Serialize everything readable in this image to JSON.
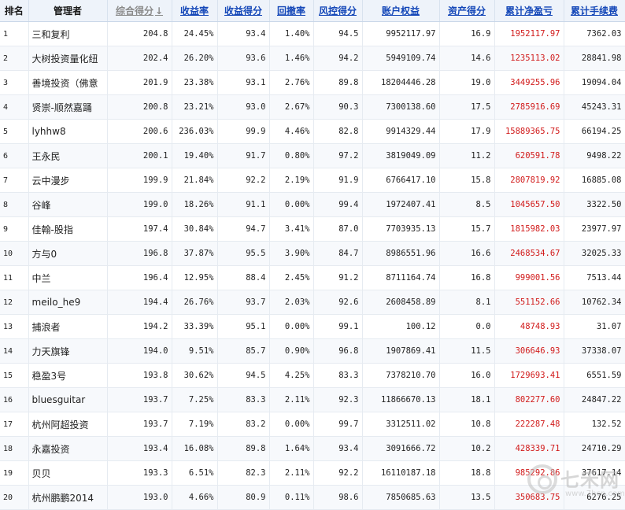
{
  "headers": {
    "rank": "排名",
    "manager": "管理者",
    "composite": "综合得分",
    "sort_arrow": "↓",
    "return_rate": "收益率",
    "return_score": "收益得分",
    "drawdown": "回撤率",
    "risk_score": "风控得分",
    "equity": "账户权益",
    "asset_score": "资产得分",
    "net_profit": "累计净盈亏",
    "fees": "累计手续费"
  },
  "rows": [
    {
      "rank": "1",
      "manager": "三和复利",
      "composite": "204.8",
      "return_rate": "24.45%",
      "return_score": "93.4",
      "drawdown": "1.40%",
      "risk_score": "94.5",
      "equity": "9952117.97",
      "asset_score": "16.9",
      "net_profit": "1952117.97",
      "fees": "7362.03"
    },
    {
      "rank": "2",
      "manager": "大树投资量化纽",
      "composite": "202.4",
      "return_rate": "26.20%",
      "return_score": "93.6",
      "drawdown": "1.46%",
      "risk_score": "94.2",
      "equity": "5949109.74",
      "asset_score": "14.6",
      "net_profit": "1235113.02",
      "fees": "28841.98"
    },
    {
      "rank": "3",
      "manager": "善境投资（佛意",
      "composite": "201.9",
      "return_rate": "23.38%",
      "return_score": "93.1",
      "drawdown": "2.76%",
      "risk_score": "89.8",
      "equity": "18204446.28",
      "asset_score": "19.0",
      "net_profit": "3449255.96",
      "fees": "19094.04"
    },
    {
      "rank": "4",
      "manager": "贤崇-顺然嘉踊",
      "composite": "200.8",
      "return_rate": "23.21%",
      "return_score": "93.0",
      "drawdown": "2.67%",
      "risk_score": "90.3",
      "equity": "7300138.60",
      "asset_score": "17.5",
      "net_profit": "2785916.69",
      "fees": "45243.31"
    },
    {
      "rank": "5",
      "manager": "lyhhw8",
      "composite": "200.6",
      "return_rate": "236.03%",
      "return_score": "99.9",
      "drawdown": "4.46%",
      "risk_score": "82.8",
      "equity": "9914329.44",
      "asset_score": "17.9",
      "net_profit": "15889365.75",
      "fees": "66194.25"
    },
    {
      "rank": "6",
      "manager": "王永民",
      "composite": "200.1",
      "return_rate": "19.40%",
      "return_score": "91.7",
      "drawdown": "0.80%",
      "risk_score": "97.2",
      "equity": "3819049.09",
      "asset_score": "11.2",
      "net_profit": "620591.78",
      "fees": "9498.22"
    },
    {
      "rank": "7",
      "manager": "云中漫步",
      "composite": "199.9",
      "return_rate": "21.84%",
      "return_score": "92.2",
      "drawdown": "2.19%",
      "risk_score": "91.9",
      "equity": "6766417.10",
      "asset_score": "15.8",
      "net_profit": "2807819.92",
      "fees": "16885.08"
    },
    {
      "rank": "8",
      "manager": "谷峰",
      "composite": "199.0",
      "return_rate": "18.26%",
      "return_score": "91.1",
      "drawdown": "0.00%",
      "risk_score": "99.4",
      "equity": "1972407.41",
      "asset_score": "8.5",
      "net_profit": "1045657.50",
      "fees": "3322.50"
    },
    {
      "rank": "9",
      "manager": "佳翰-股指",
      "composite": "197.4",
      "return_rate": "30.84%",
      "return_score": "94.7",
      "drawdown": "3.41%",
      "risk_score": "87.0",
      "equity": "7703935.13",
      "asset_score": "15.7",
      "net_profit": "1815982.03",
      "fees": "23977.97"
    },
    {
      "rank": "10",
      "manager": "方与0",
      "composite": "196.8",
      "return_rate": "37.87%",
      "return_score": "95.5",
      "drawdown": "3.90%",
      "risk_score": "84.7",
      "equity": "8986551.96",
      "asset_score": "16.6",
      "net_profit": "2468534.67",
      "fees": "32025.33"
    },
    {
      "rank": "11",
      "manager": "中兰",
      "composite": "196.4",
      "return_rate": "12.95%",
      "return_score": "88.4",
      "drawdown": "2.45%",
      "risk_score": "91.2",
      "equity": "8711164.74",
      "asset_score": "16.8",
      "net_profit": "999001.56",
      "fees": "7513.44"
    },
    {
      "rank": "12",
      "manager": "meilo_he9",
      "composite": "194.4",
      "return_rate": "26.76%",
      "return_score": "93.7",
      "drawdown": "2.03%",
      "risk_score": "92.6",
      "equity": "2608458.89",
      "asset_score": "8.1",
      "net_profit": "551152.66",
      "fees": "10762.34"
    },
    {
      "rank": "13",
      "manager": "捕浪者",
      "composite": "194.2",
      "return_rate": "33.39%",
      "return_score": "95.1",
      "drawdown": "0.00%",
      "risk_score": "99.1",
      "equity": "100.12",
      "asset_score": "0.0",
      "net_profit": "48748.93",
      "fees": "31.07"
    },
    {
      "rank": "14",
      "manager": "力天旗锋",
      "composite": "194.0",
      "return_rate": "9.51%",
      "return_score": "85.7",
      "drawdown": "0.90%",
      "risk_score": "96.8",
      "equity": "1907869.41",
      "asset_score": "11.5",
      "net_profit": "306646.93",
      "fees": "37338.07"
    },
    {
      "rank": "15",
      "manager": "稳盈3号",
      "composite": "193.8",
      "return_rate": "30.62%",
      "return_score": "94.5",
      "drawdown": "4.25%",
      "risk_score": "83.3",
      "equity": "7378210.70",
      "asset_score": "16.0",
      "net_profit": "1729693.41",
      "fees": "6551.59"
    },
    {
      "rank": "16",
      "manager": "bluesguitar",
      "composite": "193.7",
      "return_rate": "7.25%",
      "return_score": "83.3",
      "drawdown": "2.11%",
      "risk_score": "92.3",
      "equity": "11866670.13",
      "asset_score": "18.1",
      "net_profit": "802277.60",
      "fees": "24847.22"
    },
    {
      "rank": "17",
      "manager": "杭州阿超投资",
      "composite": "193.7",
      "return_rate": "7.19%",
      "return_score": "83.2",
      "drawdown": "0.00%",
      "risk_score": "99.7",
      "equity": "3312511.02",
      "asset_score": "10.8",
      "net_profit": "222287.48",
      "fees": "132.52"
    },
    {
      "rank": "18",
      "manager": "永嘉投资",
      "composite": "193.4",
      "return_rate": "16.08%",
      "return_score": "89.8",
      "drawdown": "1.64%",
      "risk_score": "93.4",
      "equity": "3091666.72",
      "asset_score": "10.2",
      "net_profit": "428339.71",
      "fees": "24710.29"
    },
    {
      "rank": "19",
      "manager": "贝贝",
      "composite": "193.3",
      "return_rate": "6.51%",
      "return_score": "82.3",
      "drawdown": "2.11%",
      "risk_score": "92.2",
      "equity": "16110187.18",
      "asset_score": "18.8",
      "net_profit": "985292.86",
      "fees": "37617.14"
    },
    {
      "rank": "20",
      "manager": "杭州鹏鹏2014",
      "composite": "193.0",
      "return_rate": "4.66%",
      "return_score": "80.9",
      "drawdown": "0.11%",
      "risk_score": "98.6",
      "equity": "7850685.63",
      "asset_score": "13.5",
      "net_profit": "350683.75",
      "fees": "6276.25"
    }
  ],
  "watermark": {
    "text": "七禾网",
    "url": "www.7hcn.com"
  }
}
